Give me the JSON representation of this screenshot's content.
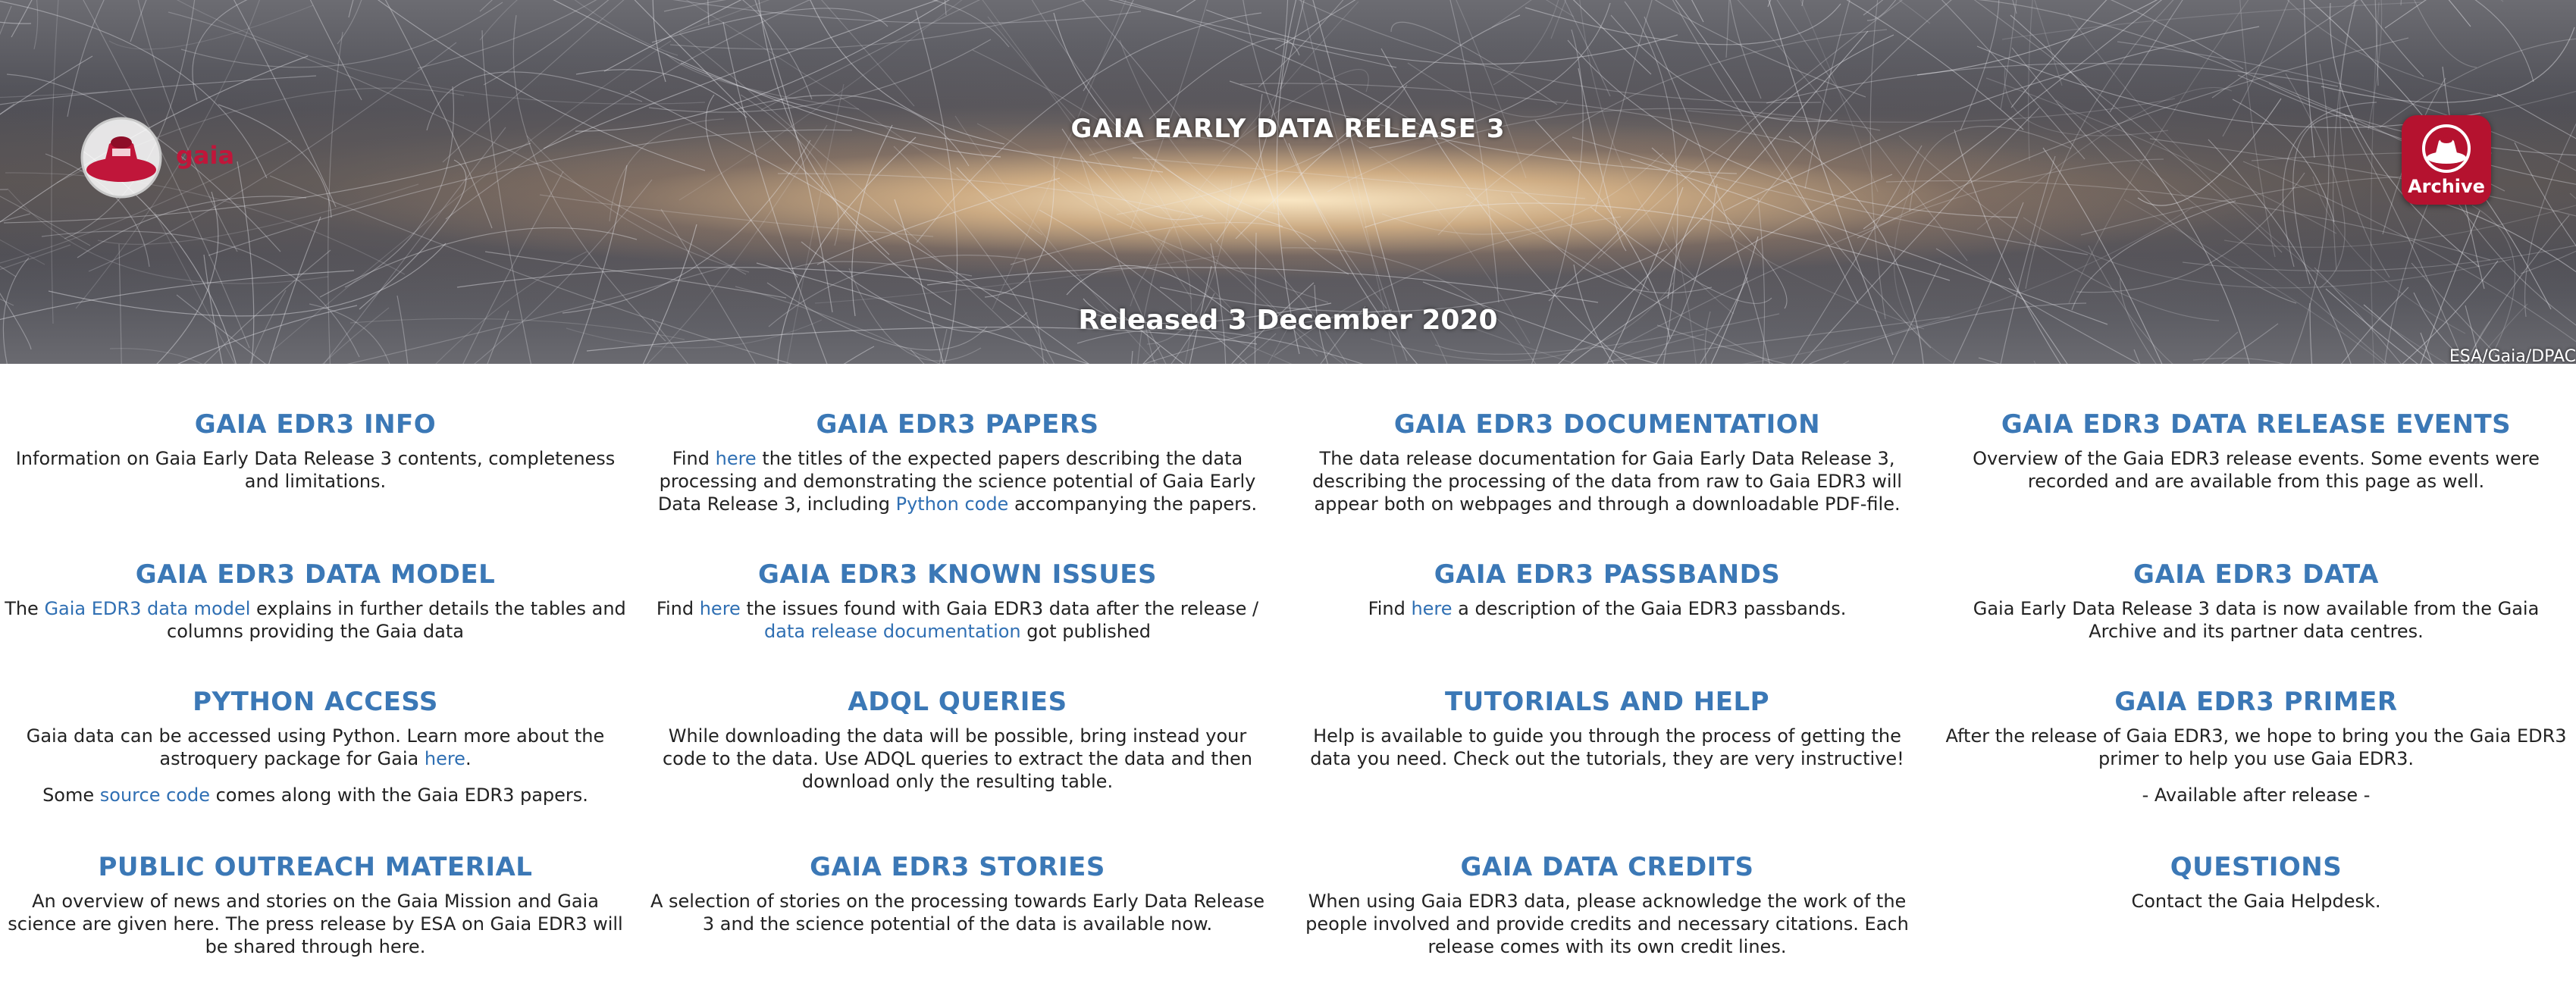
{
  "hero": {
    "title": "GAIA EARLY DATA RELEASE 3",
    "release_date": "Released 3 December 2020",
    "credit": "ESA/Gaia/DPAC",
    "logo_text": "gaia",
    "archive_label": "Archive",
    "colors": {
      "brand_red": "#c0163a",
      "link_blue": "#2f6fb3",
      "heading_blue": "#3b78b6"
    }
  },
  "tiles": {
    "info": {
      "title": "GAIA EDR3 INFO",
      "text": "Information on Gaia Early Data Release 3 contents, completeness and limitations."
    },
    "papers": {
      "title": "GAIA EDR3 PAPERS",
      "t1": "Find ",
      "link1": "here",
      "t2": " the titles of the expected papers describing the data processing and demonstrating the science potential of Gaia Early Data Release 3, including ",
      "link2": "Python code",
      "t3": " accompanying the papers."
    },
    "documentation": {
      "title": "GAIA EDR3 DOCUMENTATION",
      "text": "The data release documentation for Gaia Early Data Release 3, describing the processing of the data from raw to Gaia EDR3 will appear both on webpages and through a downloadable PDF-file."
    },
    "events": {
      "title": "GAIA EDR3 DATA RELEASE EVENTS",
      "text": "Overview of the Gaia EDR3 release events. Some events were recorded and are available from this page as well."
    },
    "data_model": {
      "title": "GAIA EDR3 DATA MODEL",
      "t1": "The ",
      "link1": "Gaia EDR3 data model",
      "t2": " explains in further details the tables and columns providing the Gaia data"
    },
    "known_issues": {
      "title": "GAIA EDR3 KNOWN ISSUES",
      "t1": "Find ",
      "link1": "here",
      "t2": " the issues found with Gaia EDR3 data after the release / ",
      "link2": "data release documentation",
      "t3": " got published"
    },
    "passbands": {
      "title": "GAIA EDR3 PASSBANDS",
      "t1": "Find ",
      "link1": "here",
      "t2": " a description of the Gaia EDR3 passbands."
    },
    "data": {
      "title": "GAIA EDR3 DATA",
      "text": "Gaia Early Data Release 3 data is now available from the Gaia Archive and its partner data centres."
    },
    "python": {
      "title": "PYTHON ACCESS",
      "t1": "Gaia data can be accessed using Python. Learn more about the astroquery package for Gaia ",
      "link1": "here",
      "t2": ".",
      "p2_t1": "Some ",
      "p2_link": "source code",
      "p2_t2": " comes along with the Gaia EDR3 papers."
    },
    "adql": {
      "title": "ADQL QUERIES",
      "text": "While downloading the data will be possible, bring instead your code to the data. Use ADQL queries to extract the data and then download only the resulting table."
    },
    "tutorials": {
      "title": "TUTORIALS AND HELP",
      "text": "Help is available to guide you through the process of getting the data you need. Check out the tutorials, they are very instructive!"
    },
    "primer": {
      "title": "GAIA EDR3 PRIMER",
      "text": "After the release of Gaia EDR3, we hope to bring you the Gaia EDR3 primer to help you use Gaia EDR3.",
      "note": "- Available after release -"
    },
    "outreach": {
      "title": "PUBLIC OUTREACH MATERIAL",
      "text": "An overview of news and stories on the Gaia Mission and Gaia science are given here. The press release by ESA on Gaia EDR3 will be shared through here."
    },
    "stories": {
      "title": "GAIA EDR3 STORIES",
      "text": "A selection of stories on the processing towards Early Data Release 3 and the science potential of the data is available now."
    },
    "credits": {
      "title": "GAIA DATA CREDITS",
      "text": "When using Gaia EDR3 data, please acknowledge the work of the people involved and provide credits and necessary citations. Each release comes with its own credit lines."
    },
    "questions": {
      "title": "QUESTIONS",
      "text": "Contact the Gaia Helpdesk."
    }
  }
}
